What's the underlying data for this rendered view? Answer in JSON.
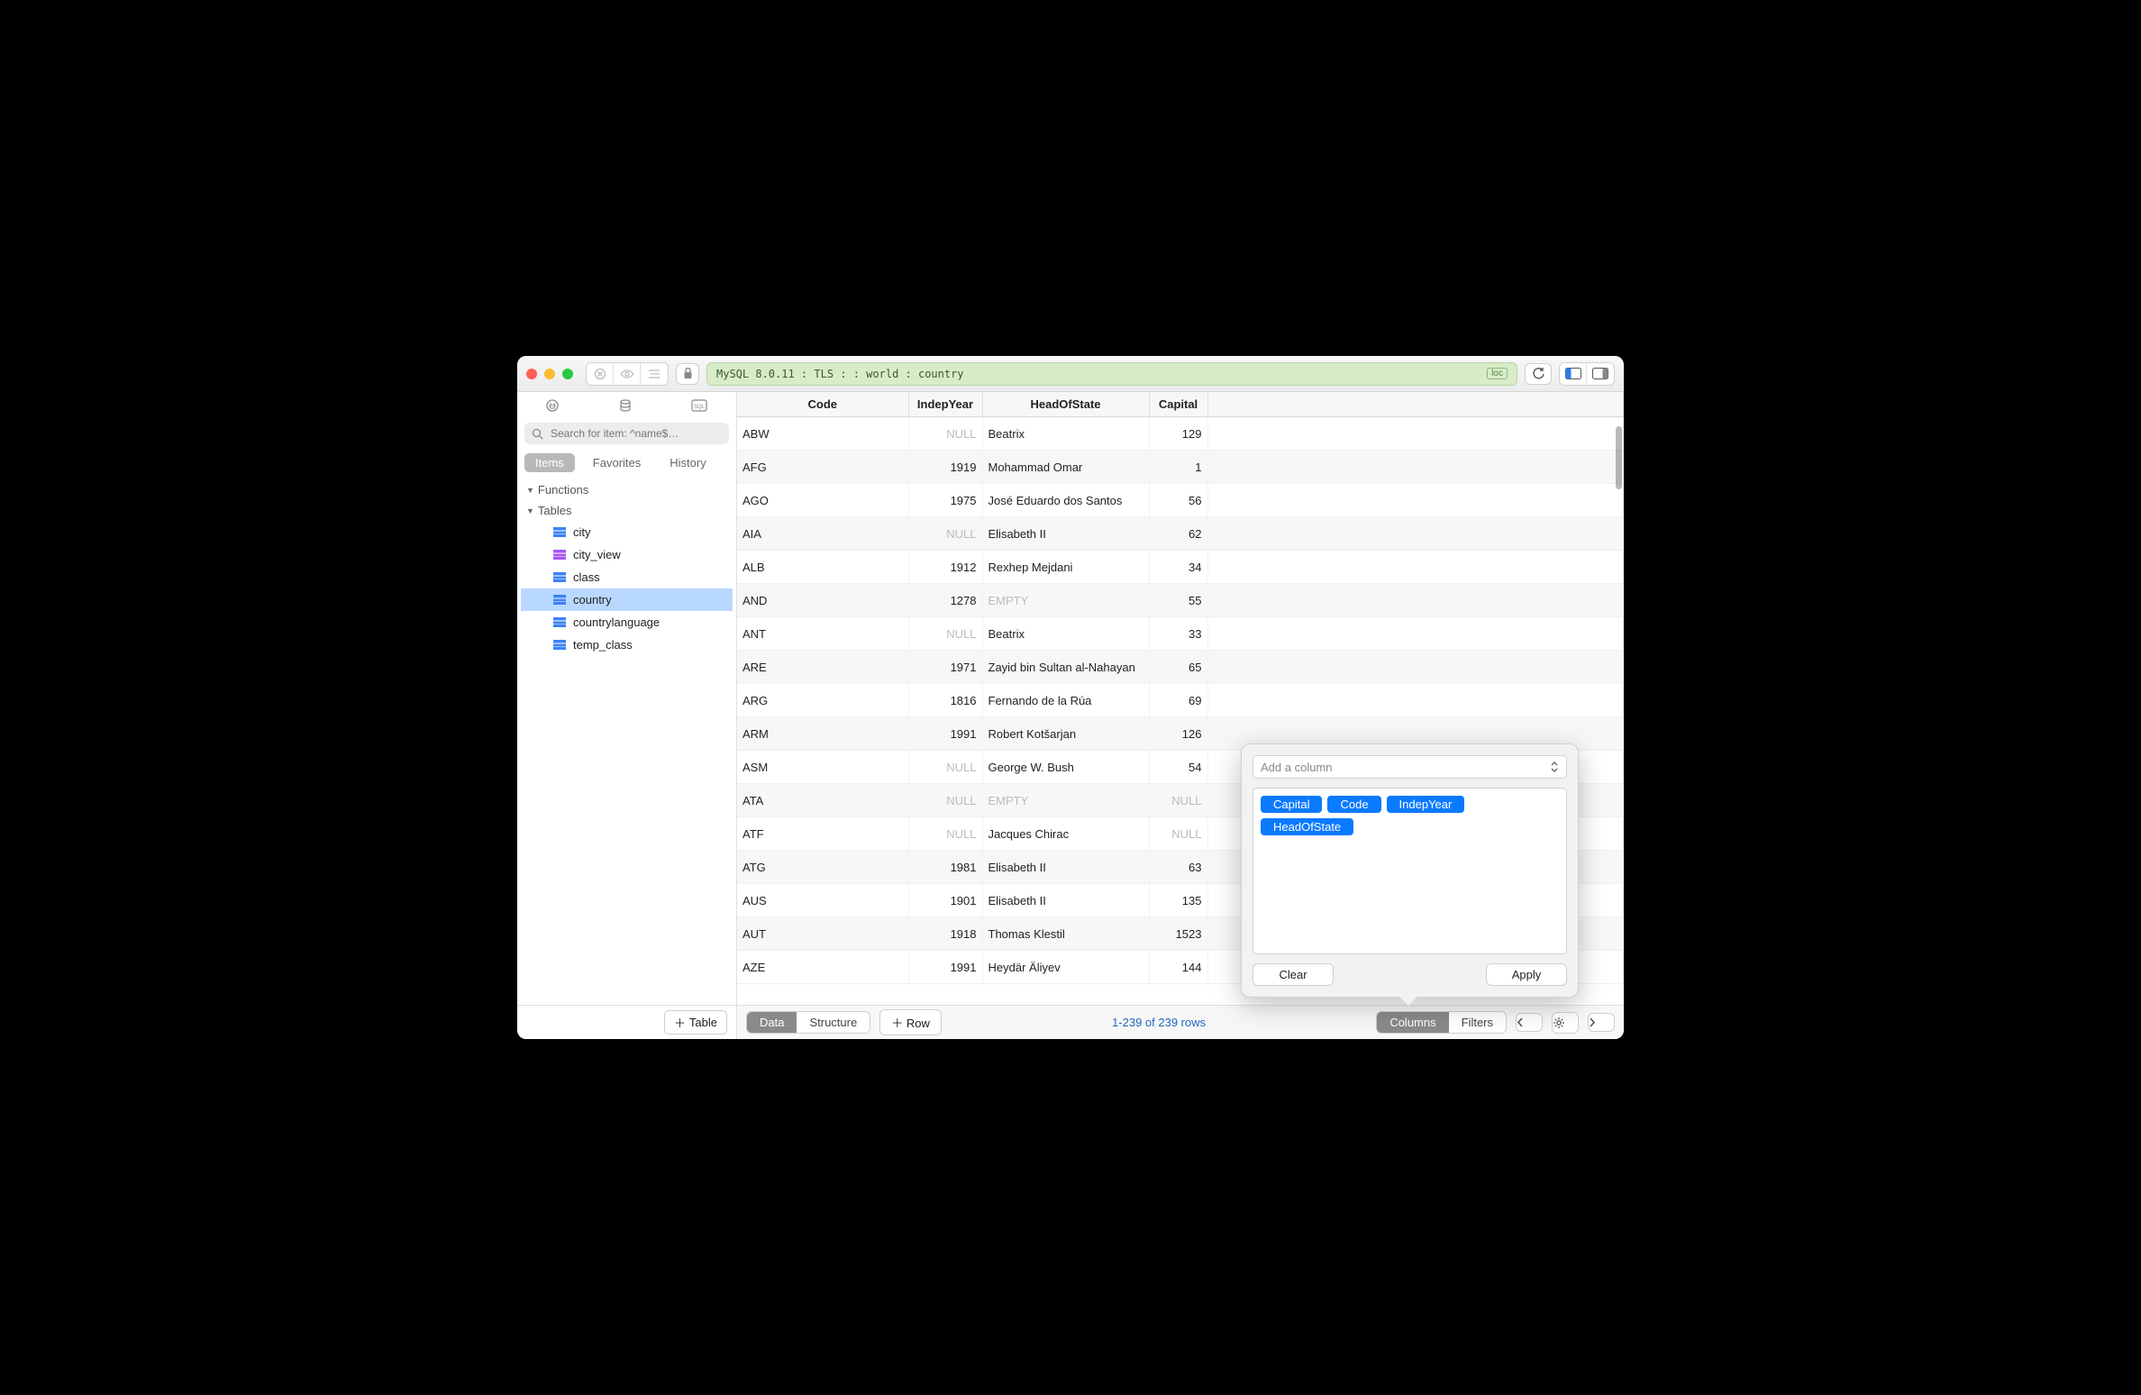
{
  "titlebar": {
    "connection_text": "MySQL 8.0.11 : TLS :  : world : country",
    "loc_badge": "loc"
  },
  "sidebar": {
    "search_placeholder": "Search for item: ^name$…",
    "tabs": {
      "items": "Items",
      "favorites": "Favorites",
      "history": "History"
    },
    "groups": {
      "functions": "Functions",
      "tables": "Tables"
    },
    "tables": [
      {
        "label": "city",
        "icon": "blue"
      },
      {
        "label": "city_view",
        "icon": "purple"
      },
      {
        "label": "class",
        "icon": "blue"
      },
      {
        "label": "country",
        "icon": "blue",
        "selected": true
      },
      {
        "label": "countrylanguage",
        "icon": "blue"
      },
      {
        "label": "temp_class",
        "icon": "blue"
      }
    ],
    "add_table": "Table"
  },
  "grid": {
    "columns": [
      "Code",
      "IndepYear",
      "HeadOfState",
      "Capital"
    ],
    "rows": [
      {
        "code": "ABW",
        "year": "NULL",
        "head": "Beatrix",
        "cap": "129"
      },
      {
        "code": "AFG",
        "year": "1919",
        "head": "Mohammad Omar",
        "cap": "1"
      },
      {
        "code": "AGO",
        "year": "1975",
        "head": "José Eduardo dos Santos",
        "cap": "56"
      },
      {
        "code": "AIA",
        "year": "NULL",
        "head": "Elisabeth II",
        "cap": "62"
      },
      {
        "code": "ALB",
        "year": "1912",
        "head": "Rexhep Mejdani",
        "cap": "34"
      },
      {
        "code": "AND",
        "year": "1278",
        "head": "EMPTY",
        "cap": "55"
      },
      {
        "code": "ANT",
        "year": "NULL",
        "head": "Beatrix",
        "cap": "33"
      },
      {
        "code": "ARE",
        "year": "1971",
        "head": "Zayid bin Sultan al-Nahayan",
        "cap": "65"
      },
      {
        "code": "ARG",
        "year": "1816",
        "head": "Fernando de la Rúa",
        "cap": "69"
      },
      {
        "code": "ARM",
        "year": "1991",
        "head": "Robert Kotšarjan",
        "cap": "126"
      },
      {
        "code": "ASM",
        "year": "NULL",
        "head": "George W. Bush",
        "cap": "54"
      },
      {
        "code": "ATA",
        "year": "NULL",
        "head": "EMPTY",
        "cap": "NULL"
      },
      {
        "code": "ATF",
        "year": "NULL",
        "head": "Jacques Chirac",
        "cap": "NULL"
      },
      {
        "code": "ATG",
        "year": "1981",
        "head": "Elisabeth II",
        "cap": "63"
      },
      {
        "code": "AUS",
        "year": "1901",
        "head": "Elisabeth II",
        "cap": "135"
      },
      {
        "code": "AUT",
        "year": "1918",
        "head": "Thomas Klestil",
        "cap": "1523"
      },
      {
        "code": "AZE",
        "year": "1991",
        "head": "Heydär Äliyev",
        "cap": "144"
      }
    ]
  },
  "footer": {
    "data": "Data",
    "structure": "Structure",
    "add_row": "Row",
    "status": "1-239 of 239 rows",
    "columns": "Columns",
    "filters": "Filters"
  },
  "popover": {
    "placeholder": "Add a column",
    "tokens": [
      "Capital",
      "Code",
      "IndepYear",
      "HeadOfState"
    ],
    "clear": "Clear",
    "apply": "Apply"
  }
}
